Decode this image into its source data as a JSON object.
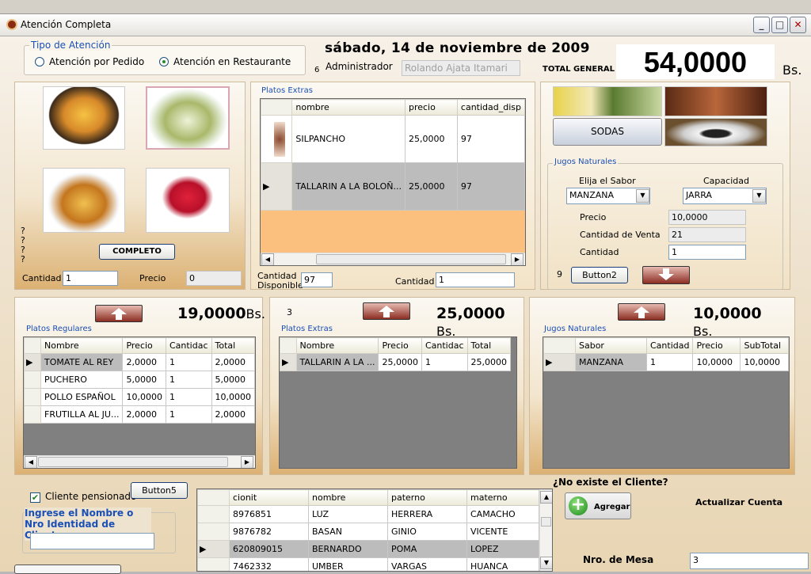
{
  "window": {
    "title": "Atención Completa"
  },
  "tipo": {
    "legend": "Tipo de Atención",
    "opt1": "Atención por Pedido",
    "opt2": "Atención en Restaurante",
    "selected": "Atención en Restaurante"
  },
  "header": {
    "date": "sábado, 14 de noviembre de 2009",
    "num6": "6",
    "admin_label": "Administrador",
    "admin_value": "Rolando Ajata Itamari",
    "total_label": "TOTAL GENERAL",
    "total_value": "54,0000",
    "total_unit": "Bs."
  },
  "left_panel": {
    "questions": [
      "?",
      "?",
      "?",
      "?"
    ],
    "completo": "COMPLETO",
    "cantidad_label": "Cantidad",
    "cantidad_value": "1",
    "precio_label": "Precio",
    "precio_value": "0"
  },
  "platos_extras_top": {
    "legend": "Platos Extras",
    "columns": [
      "nombre",
      "precio",
      "cantidad_disp"
    ],
    "rows": [
      {
        "nombre": "SILPANCHO",
        "precio": "25,0000",
        "cant": "97"
      },
      {
        "nombre": "TALLARIN A LA BOLOÑ...",
        "precio": "25,0000",
        "cant": "97"
      }
    ],
    "cantidad_disp_label1": "Cantidad",
    "cantidad_disp_label2": "Disponible",
    "cantidad_disp_value": "97",
    "cantidad_label": "Cantidad",
    "cantidad_value": "1"
  },
  "right_panel": {
    "sodas": "SODAS",
    "legend": "Jugos Naturales",
    "sabor_label": "Elija el Sabor",
    "sabor_value": "MANZANA",
    "capacidad_label": "Capacidad",
    "capacidad_value": "JARRA",
    "precio_label": "Precio",
    "precio_value": "10,0000",
    "cant_venta_label": "Cantidad de Venta",
    "cant_venta_value": "21",
    "cantidad_label": "Cantidad",
    "cantidad_value": "1",
    "num9": "9",
    "button2": "Button2"
  },
  "regulares": {
    "amount": "19,0000",
    "unit": "Bs.",
    "legend": "Platos Regulares",
    "columns": [
      "Nombre",
      "Precio",
      "Cantidac",
      "Total"
    ],
    "rows": [
      {
        "n": "TOMATE AL REY",
        "p": "2,0000",
        "c": "1",
        "t": "2,0000"
      },
      {
        "n": "PUCHERO",
        "p": "5,0000",
        "c": "1",
        "t": "5,0000"
      },
      {
        "n": "POLLO ESPAÑOL",
        "p": "10,0000",
        "c": "1",
        "t": "10,0000"
      },
      {
        "n": "FRUTILLA AL JU...",
        "p": "2,0000",
        "c": "1",
        "t": "2,0000"
      }
    ]
  },
  "extras": {
    "num3": "3",
    "amount": "25,0000",
    "unit": "Bs.",
    "legend": "Platos Extras",
    "columns": [
      "Nombre",
      "Precio",
      "Cantidac",
      "Total"
    ],
    "rows": [
      {
        "n": "TALLARIN A LA ...",
        "p": "25,0000",
        "c": "1",
        "t": "25,0000"
      }
    ]
  },
  "jugos": {
    "amount": "10,0000",
    "unit": "Bs.",
    "legend": "Jugos Naturales",
    "columns": [
      "Sabor",
      "Cantidad",
      "Precio",
      "SubTotal"
    ],
    "rows": [
      {
        "n": "MANZANA",
        "c": "1",
        "p": "10,0000",
        "t": "10,0000"
      }
    ]
  },
  "cliente": {
    "pensionado_label": "Cliente pensionado",
    "button5": "Button5",
    "ingrese_legend": "Ingrese el Nombre o Nro Identidad de Cliente",
    "columns": [
      "cionit",
      "nombre",
      "paterno",
      "materno"
    ],
    "rows": [
      {
        "ci": "8976851",
        "n": "LUZ",
        "p": "HERRERA",
        "m": "CAMACHO"
      },
      {
        "ci": "9876782",
        "n": "BASAN",
        "p": "GINIO",
        "m": "VICENTE"
      },
      {
        "ci": "620809015",
        "n": "BERNARDO",
        "p": "POMA",
        "m": "LOPEZ"
      },
      {
        "ci": "7462332",
        "n": "UMBER",
        "p": "VARGAS",
        "m": "HUANCA"
      }
    ],
    "no_existe": "¿No existe el Cliente?",
    "agregar": "Agregar",
    "actualizar": "Actualizar Cuenta",
    "mesa_label": "Nro. de Mesa",
    "mesa_value": "3"
  },
  "colors": {
    "legend_blue": "#1a4fb5",
    "panel_tan": "#dcb173",
    "selected_row": "#bcbcbc"
  }
}
